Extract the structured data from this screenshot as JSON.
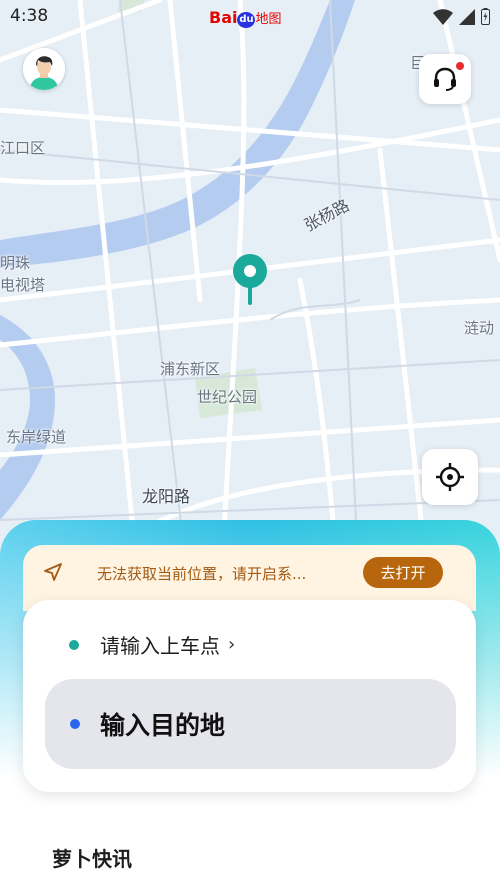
{
  "status_bar": {
    "time": "4:38"
  },
  "map": {
    "brand": {
      "latin": "Bai",
      "paw": "du",
      "chinese": "地图"
    },
    "labels": {
      "district_left": "江口区",
      "pearl_line1": "明珠",
      "pearl_line2": "电视塔",
      "zhangyang_rd": "张杨路",
      "pudong_new_area": "浦东新区",
      "century_park": "世纪公园",
      "east_bank_greenway": "东岸绿道",
      "longyang_rd": "龙阳路",
      "top_right": "巨峰路",
      "right_edge": "涟动"
    }
  },
  "notice": {
    "text": "无法获取当前位置，请开启系...",
    "button": "去打开",
    "icon": "navigation-arrow-icon"
  },
  "trip": {
    "pickup_label": "请输入上车点",
    "pickup_chevron": "›",
    "destination_label": "输入目的地",
    "pickup_color": "#1aa99a",
    "destination_color": "#2a64f0"
  },
  "news": {
    "title": "萝卜快讯"
  },
  "colors": {
    "accent": "#1aa99a",
    "notice_button": "#b7660d",
    "notice_text": "#a35a12"
  }
}
